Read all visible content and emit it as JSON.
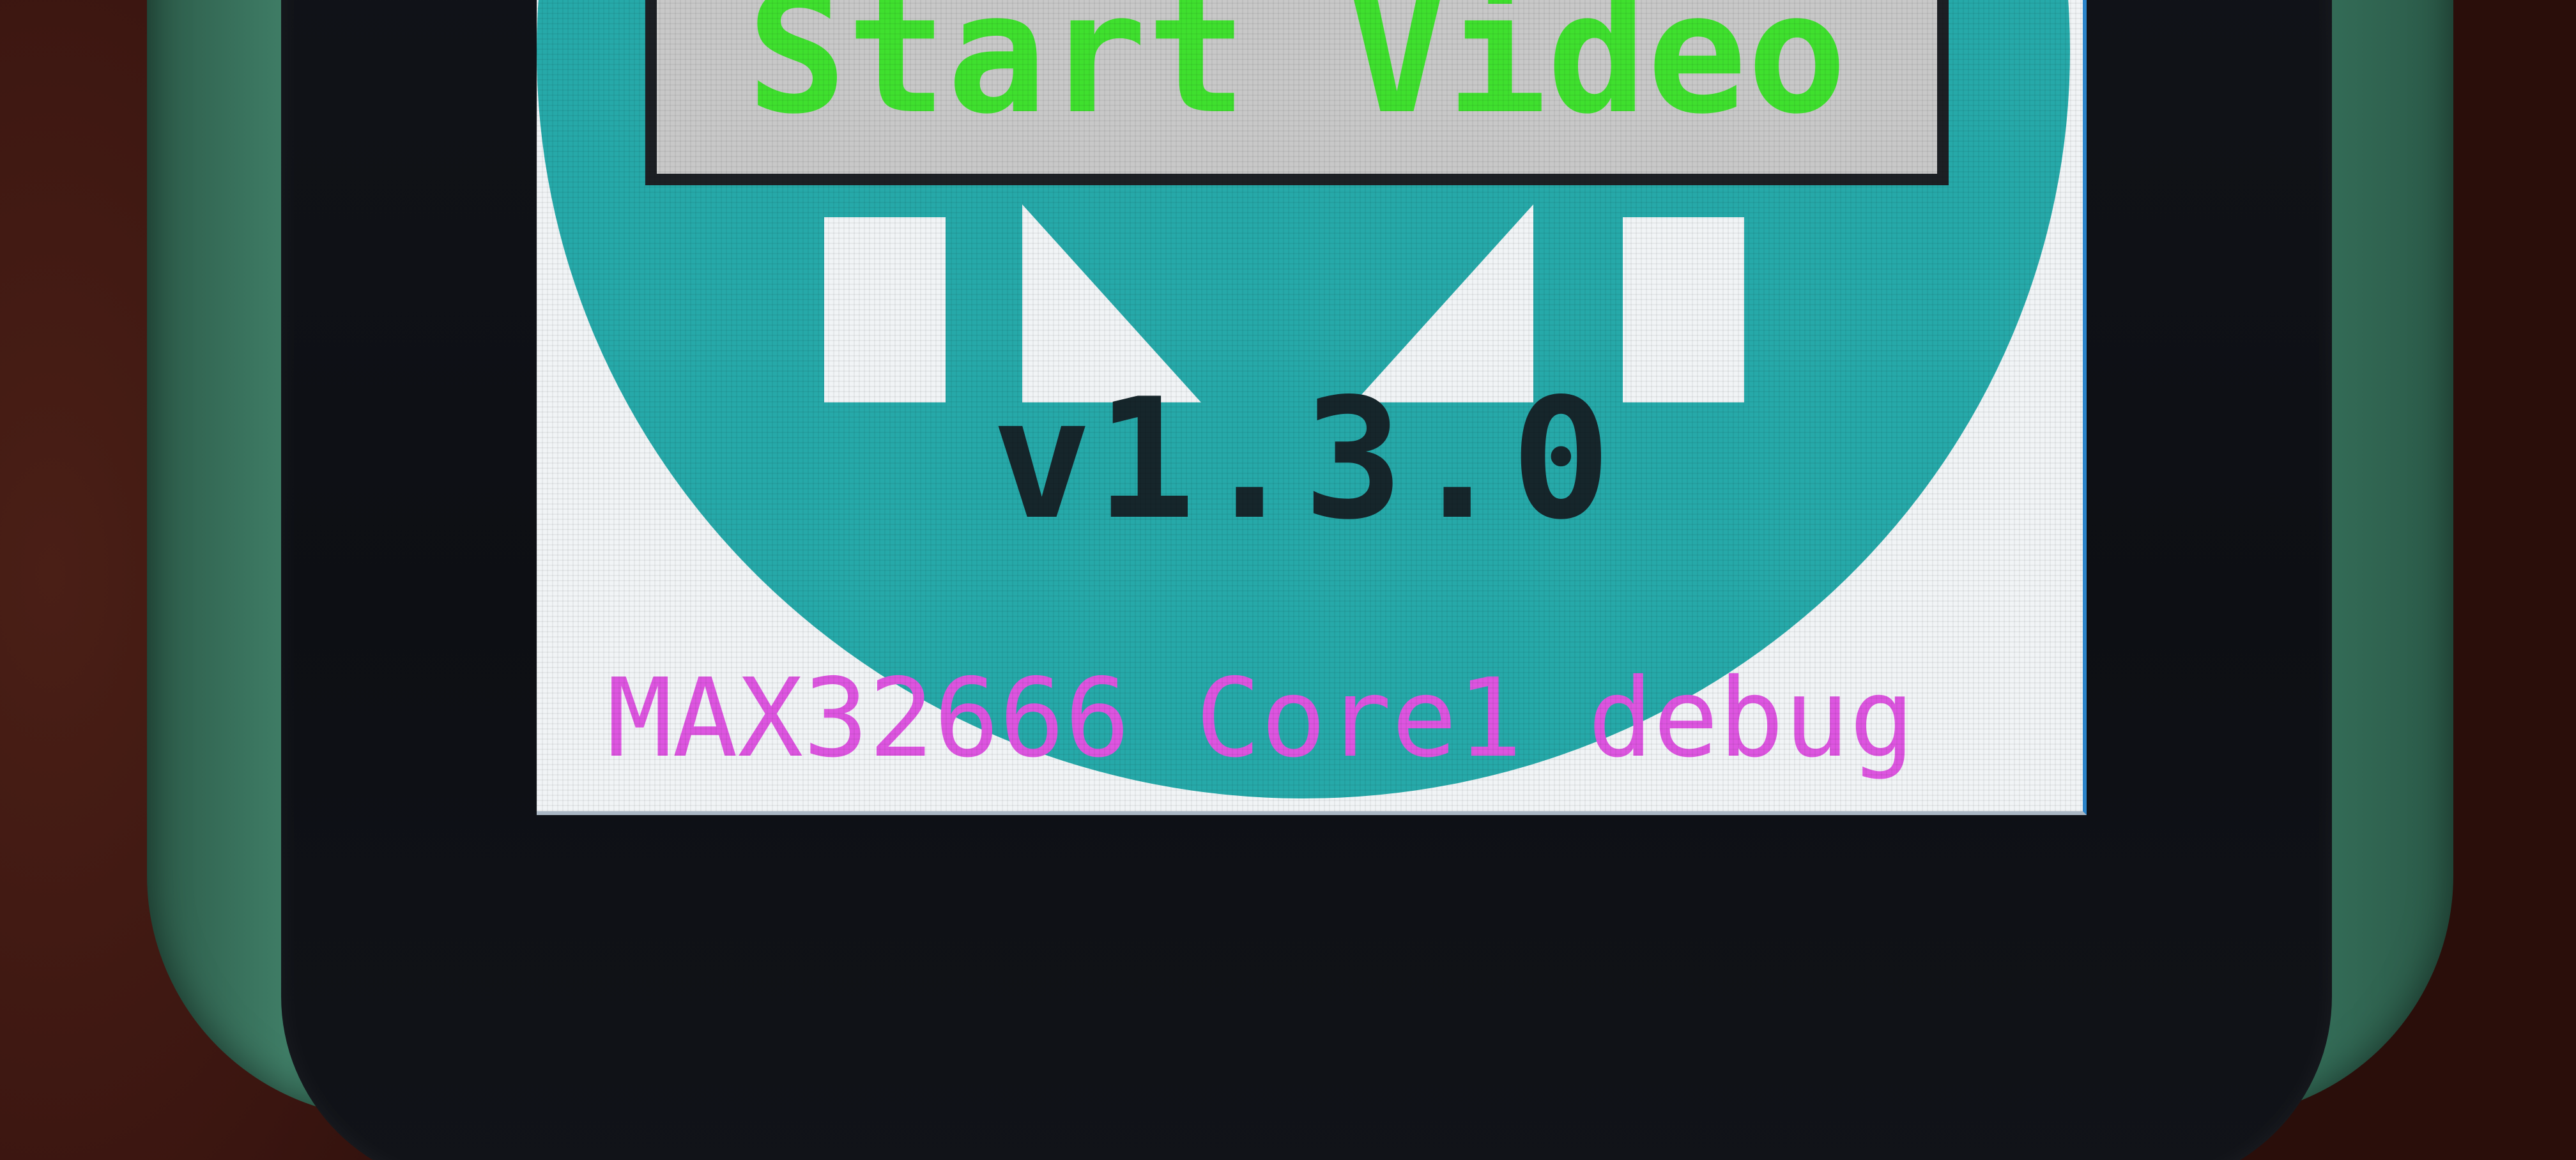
{
  "screen": {
    "button_label": "Start Video",
    "version": "v1.3.0",
    "debug_line": "MAX32666 Core1 debug"
  },
  "colors": {
    "logo_teal": "#26a9a9",
    "button_text_green": "#3fe02e",
    "debug_text_magenta": "#dd55e0",
    "case_green": "#35705a"
  }
}
